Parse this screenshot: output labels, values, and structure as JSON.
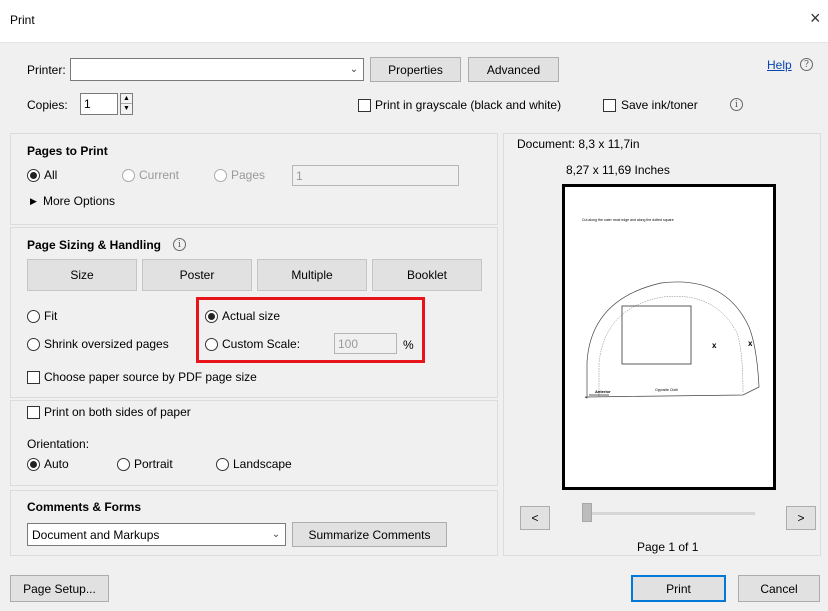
{
  "window": {
    "title": "Print",
    "close_glyph": "×"
  },
  "printer": {
    "label": "Printer:",
    "value": "",
    "properties": "Properties",
    "advanced": "Advanced",
    "help": "Help",
    "help_icon": "?"
  },
  "copies": {
    "label": "Copies:",
    "value": "1"
  },
  "options": {
    "grayscale": "Print in grayscale (black and white)",
    "save_ink": "Save ink/toner"
  },
  "pages_to_print": {
    "title": "Pages to Print",
    "all": "All",
    "current": "Current",
    "pages": "Pages",
    "pages_value": "1",
    "more_options": "More Options"
  },
  "sizing": {
    "title": "Page Sizing & Handling",
    "tabs": [
      "Size",
      "Poster",
      "Multiple",
      "Booklet"
    ],
    "fit": "Fit",
    "actual_size": "Actual size",
    "shrink": "Shrink oversized pages",
    "custom_scale": "Custom Scale:",
    "custom_scale_value": "100",
    "percent": "%",
    "paper_source": "Choose paper source by PDF page size"
  },
  "duplex": {
    "both_sides": "Print on both sides of paper",
    "orientation_label": "Orientation:",
    "auto": "Auto",
    "portrait": "Portrait",
    "landscape": "Landscape"
  },
  "comments": {
    "title": "Comments & Forms",
    "value": "Document and Markups",
    "summarize": "Summarize Comments"
  },
  "preview": {
    "document_size": "Document: 8,3 x 11,7in",
    "inches": "8,27 x 11,69 Inches",
    "page_heading": "Cut along the outer most edge and along the dotted square",
    "page_footer": "Opposite Cloth",
    "page_left_label": "Anterior",
    "prev": "<",
    "next": ">",
    "page_indicator": "Page 1 of 1",
    "mark_x": "x"
  },
  "footer": {
    "page_setup": "Page Setup...",
    "print": "Print",
    "cancel": "Cancel"
  },
  "colors": {
    "highlight": "#e8141c",
    "link": "#0645ad"
  }
}
